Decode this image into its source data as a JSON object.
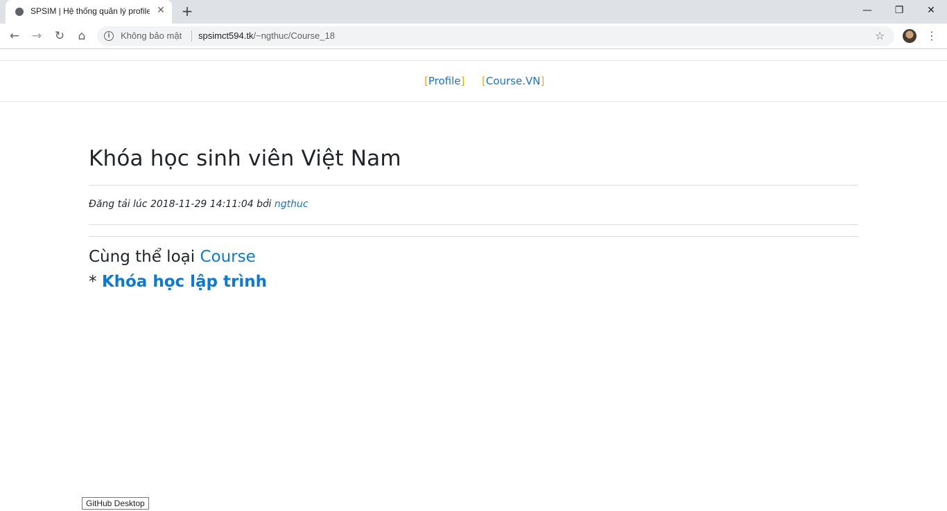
{
  "browser": {
    "tab_title": "SPSIM | Hệ thống quản lý profile",
    "security_label": "Không bảo mật",
    "url_host": "spsimct594.tk",
    "url_path": "/~ngthuc/Course_18"
  },
  "nav": {
    "profile_label": "Profile",
    "course_label": "Course.VN"
  },
  "article": {
    "title": "Khóa học sinh viên Việt Nam",
    "posted_prefix": "Đăng tải lúc 2018-11-29 14:11:04 bởi",
    "author": "ngthuc"
  },
  "related": {
    "heading": "Cùng thể loại",
    "category": "Course",
    "bullet": "*",
    "items": [
      {
        "label": "Khóa học lập trình"
      }
    ]
  },
  "tooltip": "GitHub Desktop",
  "icons": {
    "back": "arrow-left",
    "forward": "arrow-right",
    "reload": "reload",
    "home": "home",
    "info": "info",
    "bookmark": "star",
    "menu": "kebab"
  }
}
